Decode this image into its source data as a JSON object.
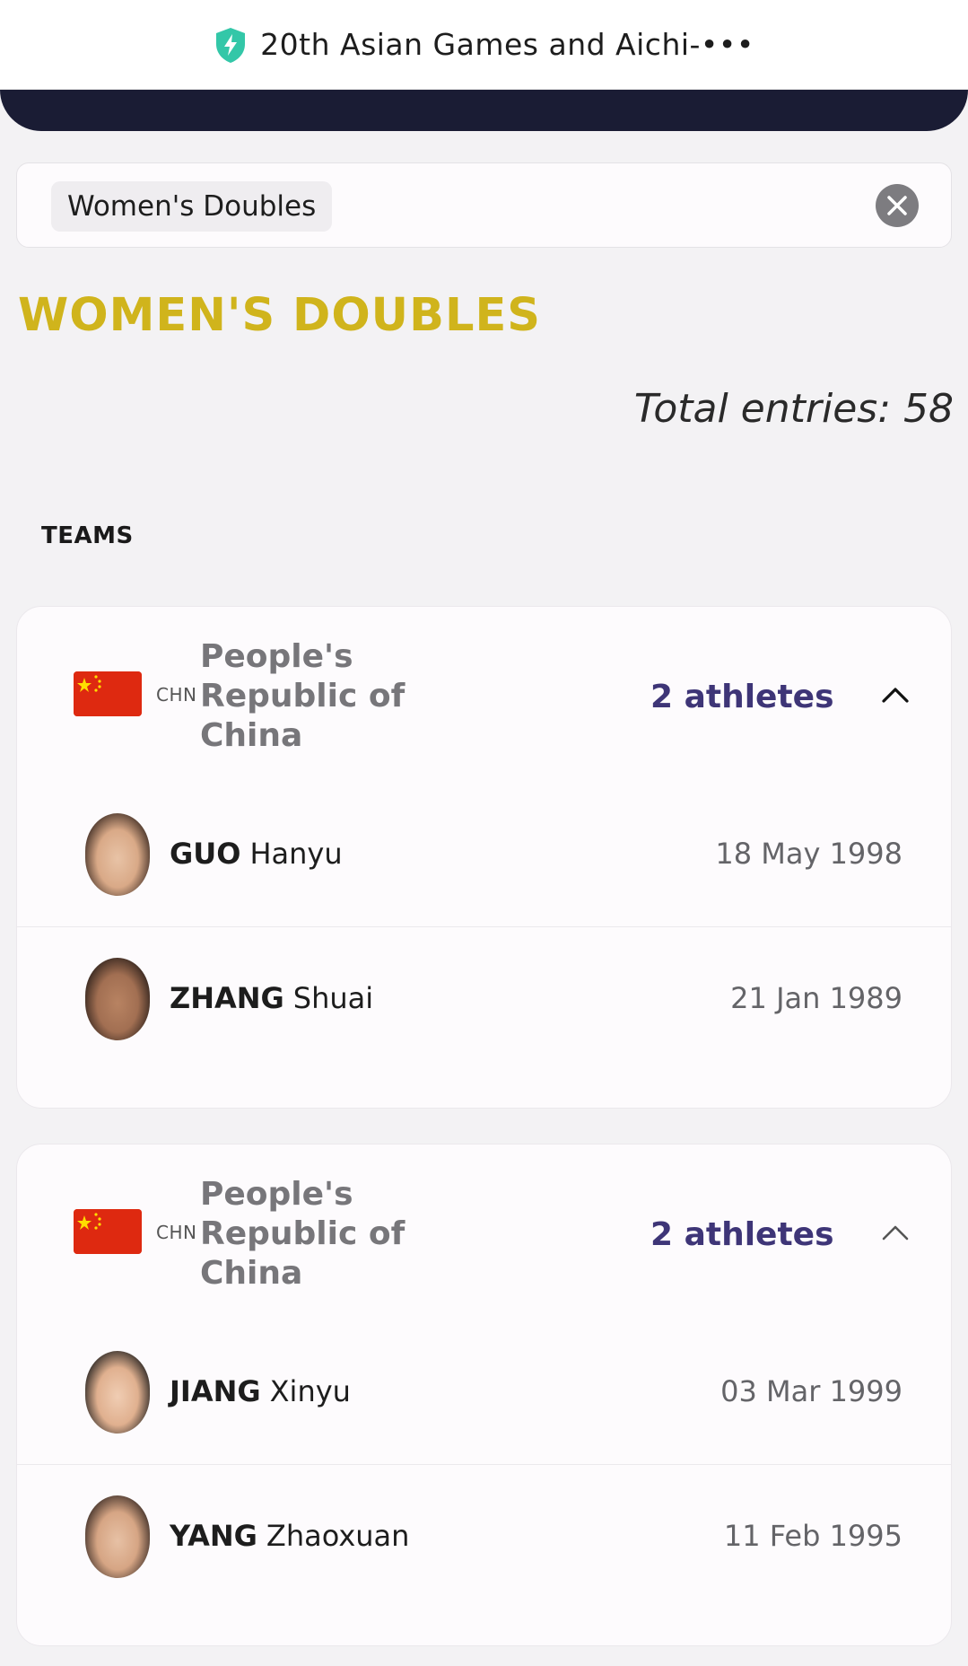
{
  "header": {
    "title": "20th Asian Games and Aichi-•••",
    "icon": "shield-bolt-icon"
  },
  "filter": {
    "chip_label": "Women's Doubles",
    "clear_icon": "close-circle-icon"
  },
  "page": {
    "title": "WOMEN'S DOUBLES",
    "total_entries": "Total entries: 58",
    "section_label": "TEAMS"
  },
  "teams": [
    {
      "noc": "CHN",
      "country_line1": "People's",
      "country_line2": "Republic of",
      "country_line3": "China",
      "athletes_count": "2 athletes",
      "athletes": [
        {
          "surname": "GUO",
          "given": "Hanyu",
          "dob": "18 May 1998"
        },
        {
          "surname": "ZHANG",
          "given": "Shuai",
          "dob": "21 Jan 1989"
        }
      ]
    },
    {
      "noc": "CHN",
      "country_line1": "People's",
      "country_line2": "Republic of",
      "country_line3": "China",
      "athletes_count": "2 athletes",
      "athletes": [
        {
          "surname": "JIANG",
          "given": "Xinyu",
          "dob": "03 Mar 1999"
        },
        {
          "surname": "YANG",
          "given": "Zhaoxuan",
          "dob": "11 Feb 1995"
        }
      ]
    }
  ],
  "colors": {
    "title_gold": "#d0b41c",
    "athletes_purple": "#3e3577",
    "flag_red": "#de2910",
    "flag_star": "#ffde00",
    "nav_dark": "#1a1c34",
    "shield_teal": "#33c7a8"
  }
}
